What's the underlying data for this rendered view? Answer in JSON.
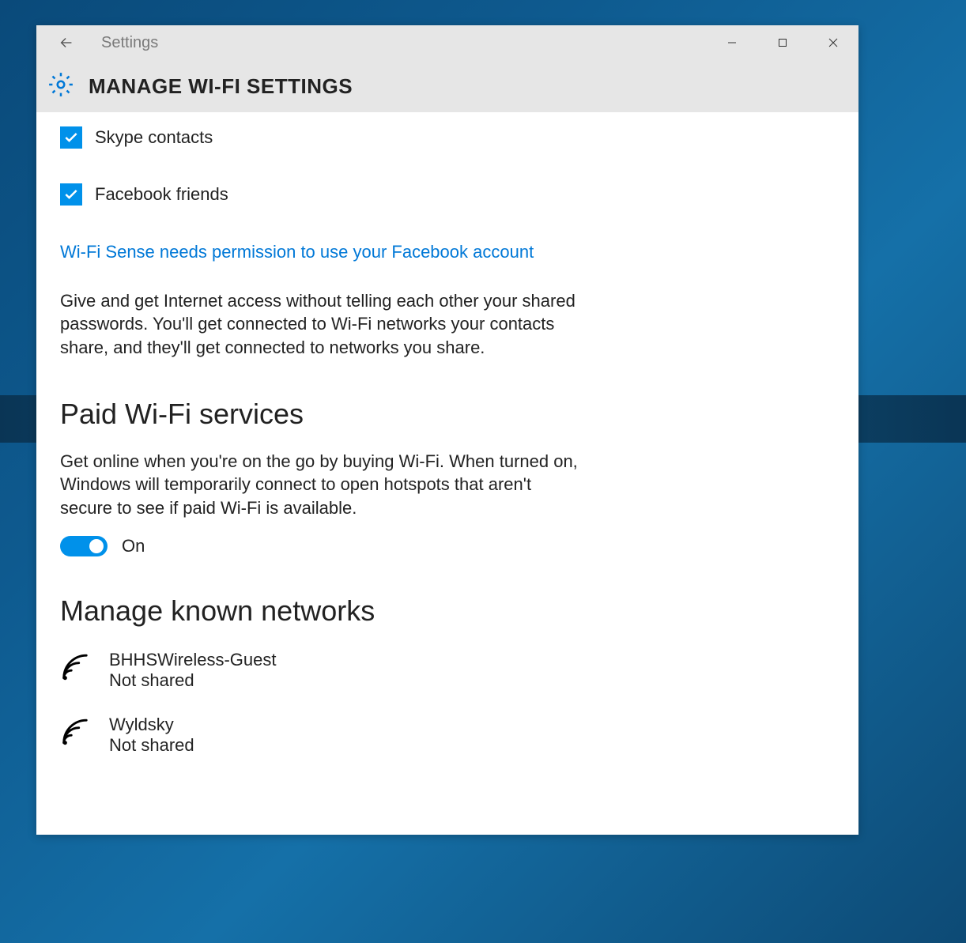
{
  "window": {
    "app_title": "Settings",
    "page_heading": "MANAGE WI-FI SETTINGS"
  },
  "checkboxes": [
    {
      "label": "Skype contacts",
      "checked": true
    },
    {
      "label": "Facebook friends",
      "checked": true
    }
  ],
  "permission_link": "Wi-Fi Sense needs permission to use your Facebook account",
  "description": "Give and get Internet access without telling each other your shared passwords. You'll get connected to Wi-Fi networks your contacts share, and they'll get connected to networks you share.",
  "paid_section": {
    "heading": "Paid Wi-Fi services",
    "description": "Get online when you're on the go by buying Wi-Fi. When turned on, Windows will temporarily connect to open hotspots that aren't secure to see if paid Wi-Fi is available.",
    "toggle_state": "On"
  },
  "known_networks": {
    "heading": "Manage known networks",
    "items": [
      {
        "name": "BHHSWireless-Guest",
        "status": "Not shared"
      },
      {
        "name": "Wyldsky",
        "status": "Not shared"
      }
    ]
  }
}
